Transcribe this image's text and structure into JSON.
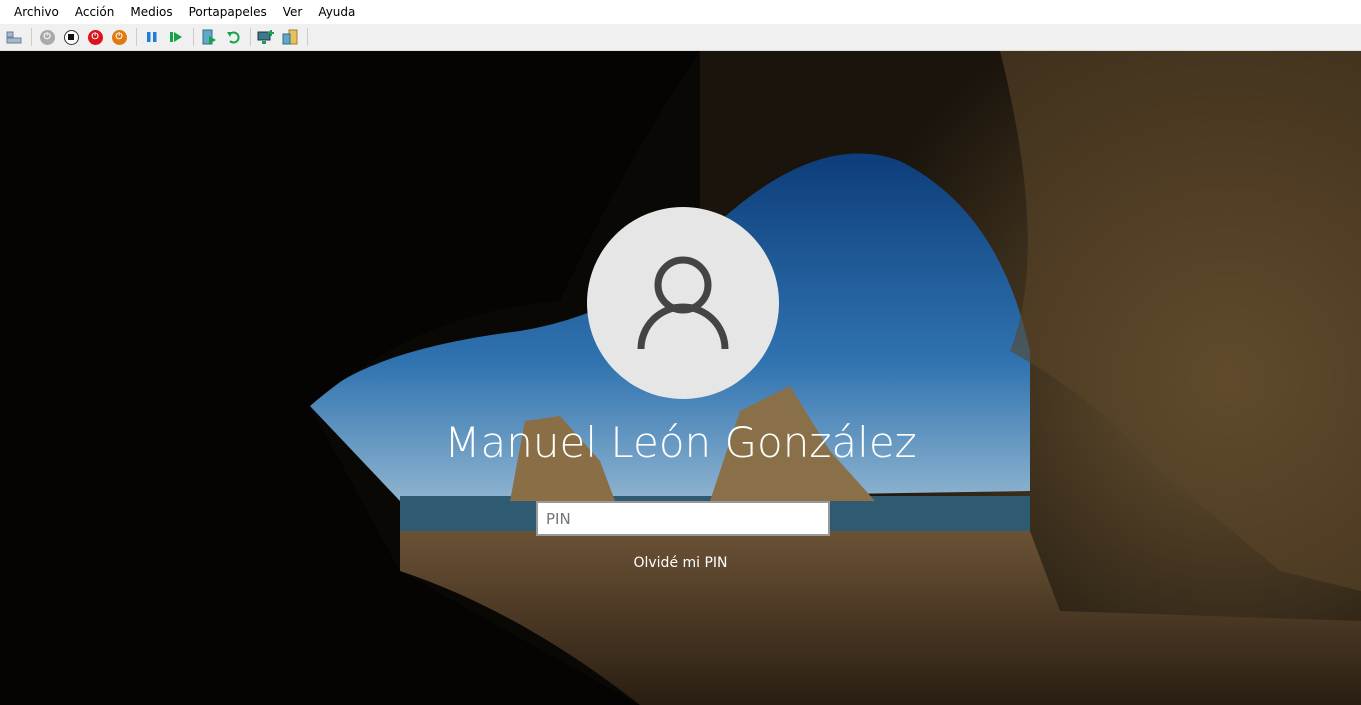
{
  "menu": [
    "Archivo",
    "Acción",
    "Medios",
    "Portapapeles",
    "Ver",
    "Ayuda"
  ],
  "toolbar": [
    "ctrl-alt-del-icon",
    "start-icon",
    "turn-off-icon",
    "shutdown-icon",
    "save-icon",
    "pause-icon",
    "reset-icon",
    "checkpoint-icon",
    "revert-icon",
    "enhanced-session-icon",
    "share-icon"
  ],
  "login": {
    "user_name": "Manuel León González",
    "pin_placeholder": "PIN",
    "forgot_pin": "Olvidé mi PIN"
  },
  "colors": {
    "avatar_bg": "#e6e6e6",
    "shutdown_red": "#d9141b",
    "save_orange": "#e07a10",
    "accent_blue": "#1e7fd6",
    "accent_green": "#16a34a"
  }
}
